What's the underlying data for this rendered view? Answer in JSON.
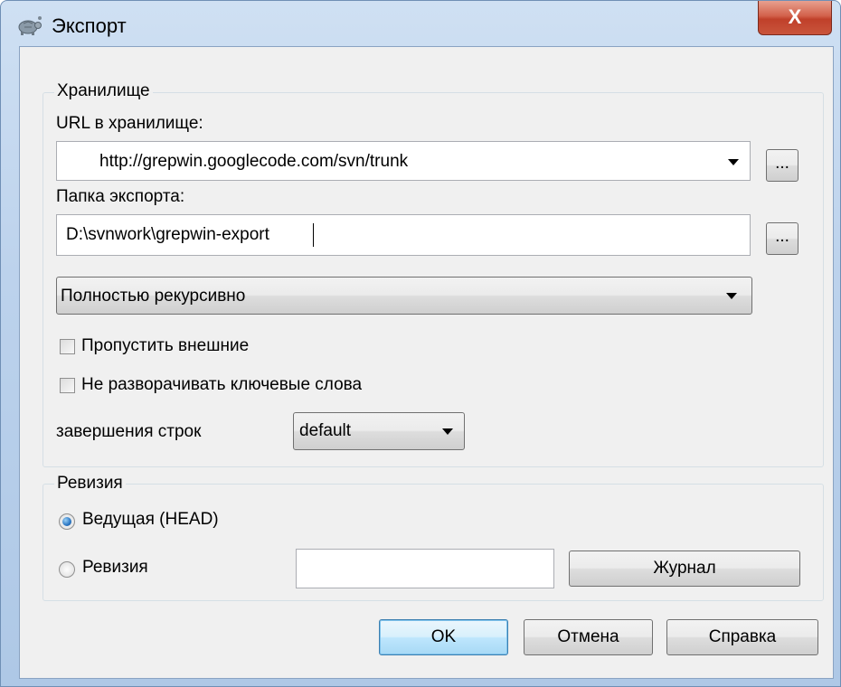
{
  "window": {
    "title": "Экспорт",
    "close_label": "X",
    "app_icon": "tortoise-icon"
  },
  "repository": {
    "legend": "Хранилище",
    "url_label": "URL в хранилище:",
    "url_value": "http://grepwin.googlecode.com/svn/trunk",
    "browse_label": "...",
    "export_folder_label": "Папка экспорта:",
    "export_folder_value": "D:\\svnwork\\grepwin-export",
    "folder_browse_label": "...",
    "depth_value": "Полностью рекурсивно",
    "omit_externals_label": "Пропустить внешние",
    "omit_externals_checked": false,
    "no_keywords_label": "Не разворачивать ключевые слова",
    "no_keywords_checked": false,
    "eol_label": "завершения строк",
    "eol_value": "default"
  },
  "revision": {
    "legend": "Ревизия",
    "head_label": "Ведущая (HEAD)",
    "head_selected": true,
    "revision_label": "Ревизия",
    "revision_selected": false,
    "revision_value": "",
    "log_button_label": "Журнал"
  },
  "buttons": {
    "ok": "OK",
    "cancel": "Отмена",
    "help": "Справка"
  },
  "colors": {
    "frame": "#bcd2ec",
    "close_button": "#c9553c",
    "dialog_bg": "#f0f0f0",
    "radio_selected": "#2a76c4"
  }
}
